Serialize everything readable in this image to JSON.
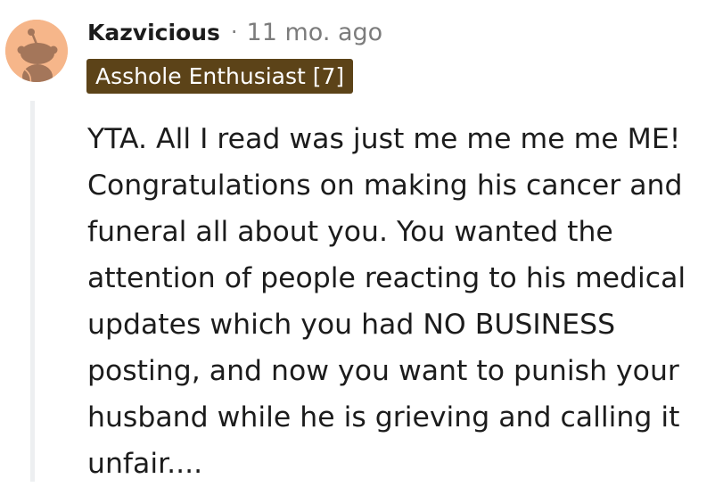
{
  "comment": {
    "author": "Kazvicious",
    "separator": "·",
    "timestamp": "11 mo. ago",
    "flair": "Asshole Enthusiast [7]",
    "body": "YTA. All I read was just me me me me ME! Congratulations on making his cancer and funeral all about you. You wanted the attention of people reacting to his medical updates which you had NO BUSINESS posting, and now you want to punish your husband while he is grieving and calling it unfair...."
  },
  "colors": {
    "avatar_bg": "#f6b68a",
    "avatar_figure": "#a4765a",
    "flair_bg": "#5c4318",
    "flair_text": "#ffffff",
    "meta_text": "#7c7c7c",
    "body_text": "#1c1c1c",
    "thread_line": "#edeff1"
  },
  "icons": {
    "avatar": "snoo-avatar-icon"
  }
}
